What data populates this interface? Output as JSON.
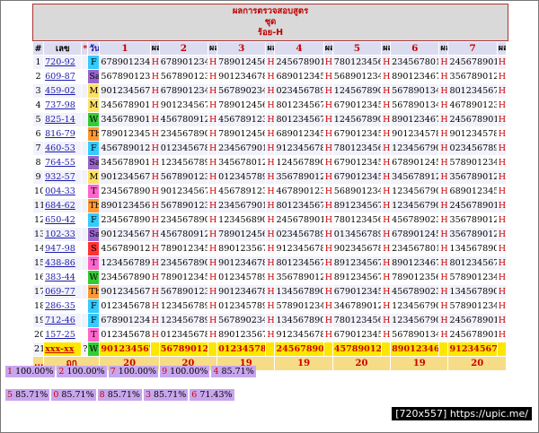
{
  "header": {
    "line1": "ผลการตรวจสอบสูตร",
    "line2": "ชุด",
    "line3": "ร้อย-H"
  },
  "columns": {
    "idx": "#",
    "label": "เลข",
    "star": "*",
    "day": "วัน",
    "digits": [
      "1",
      "2",
      "3",
      "4",
      "5",
      "6",
      "7"
    ],
    "pl": "ผล"
  },
  "day_colors": {
    "F": "#33ccff",
    "Sa": "#9966cc",
    "M": "#ffe066",
    "W": "#33cc33",
    "Th": "#ff9933",
    "S": "#ff3333",
    "T": "#ff66cc",
    "?": "#ffffff"
  },
  "rows": [
    {
      "i": "1",
      "label": "720-92",
      "day": "F",
      "vals": [
        "678901234",
        "678901234",
        "789012456",
        "245678901",
        "780123456",
        "234567801",
        "245678901"
      ],
      "res": [
        "H",
        "H",
        "H",
        "H",
        "H",
        "H",
        "H"
      ]
    },
    {
      "i": "2",
      "label": "609-87",
      "day": "Sa",
      "vals": [
        "567890123",
        "567890123",
        "901234678",
        "689012345",
        "568901234",
        "890123467",
        "356789012"
      ],
      "res": [
        "H",
        "H",
        "H",
        "H",
        "H",
        "H",
        "H"
      ]
    },
    {
      "i": "3",
      "label": "459-02",
      "day": "M",
      "vals": [
        "901234567",
        "678901234",
        "567890234",
        "023456789",
        "124567890",
        "567890134",
        "801234567"
      ],
      "res": [
        "H",
        "H",
        "H",
        "H",
        "H",
        "H",
        "H"
      ]
    },
    {
      "i": "4",
      "label": "737-98",
      "day": "M",
      "vals": [
        "345678901",
        "901234567",
        "789012456",
        "801234567",
        "679012345",
        "567890134",
        "467890123"
      ],
      "res": [
        "H",
        "H",
        "H",
        "H",
        "H",
        "H",
        "H"
      ]
    },
    {
      "i": "5",
      "label": "825-14",
      "day": "W",
      "vals": [
        "345678901",
        "456780912",
        "456789123",
        "801234567",
        "124567890",
        "890123467",
        "245678901"
      ],
      "res": [
        "H",
        "H",
        "H",
        "H",
        "H",
        "H",
        "H"
      ]
    },
    {
      "i": "6",
      "label": "816-79",
      "day": "Th",
      "vals": [
        "789012345",
        "234567890",
        "789012456",
        "689012345",
        "679012345",
        "901234578",
        "901234578"
      ],
      "res": [
        "H",
        "H",
        "H",
        "H",
        "H",
        "H",
        "H"
      ]
    },
    {
      "i": "7",
      "label": "460-53",
      "day": "F",
      "vals": [
        "456789012",
        "012345678",
        "234567901",
        "912345678",
        "780123456",
        "123456790",
        "023456789"
      ],
      "res": [
        "H",
        "H",
        "H",
        "H",
        "H",
        "H",
        "H"
      ]
    },
    {
      "i": "8",
      "label": "764-55",
      "day": "Sa",
      "vals": [
        "345678901",
        "123456789",
        "345678012",
        "124567890",
        "679012345",
        "678901245",
        "578901234"
      ],
      "res": [
        "H",
        "H",
        "H",
        "H",
        "H",
        "H",
        "H"
      ]
    },
    {
      "i": "9",
      "label": "932-57",
      "day": "M",
      "vals": [
        "901234567",
        "567890123",
        "012345789",
        "356789012",
        "679012345",
        "345678912",
        "356789012"
      ],
      "res": [
        "H",
        "H",
        "H",
        "H",
        "H",
        "H",
        "H"
      ]
    },
    {
      "i": "10",
      "label": "004-33",
      "day": "T",
      "vals": [
        "234567890",
        "901234567",
        "456789123",
        "467890123",
        "568901234",
        "123456790",
        "689012345"
      ],
      "res": [
        "H",
        "H",
        "H",
        "H",
        "H",
        "H",
        "H"
      ]
    },
    {
      "i": "11",
      "label": "684-62",
      "day": "Th",
      "vals": [
        "890123456",
        "567890123",
        "234567901",
        "801234567",
        "891234567",
        "123456790",
        "245678901"
      ],
      "res": [
        "H",
        "H",
        "H",
        "H",
        "H",
        "H",
        "H"
      ]
    },
    {
      "i": "12",
      "label": "650-42",
      "day": "F",
      "vals": [
        "234567890",
        "234567890",
        "123456890",
        "245678901",
        "780123456",
        "456789023",
        "356789012"
      ],
      "res": [
        "H",
        "H",
        "H",
        "H",
        "H",
        "H",
        "H"
      ]
    },
    {
      "i": "13",
      "label": "102-33",
      "day": "Sa",
      "vals": [
        "901234567",
        "456780912",
        "789012456",
        "023456789",
        "013456789",
        "678901245",
        "356789012"
      ],
      "res": [
        "H",
        "H",
        "H",
        "H",
        "H",
        "H",
        "H"
      ]
    },
    {
      "i": "14",
      "label": "947-98",
      "day": "S",
      "vals": [
        "456789012",
        "789012345",
        "890123567",
        "912345678",
        "902345678",
        "234567801",
        "134567890"
      ],
      "res": [
        "H",
        "H",
        "H",
        "H",
        "H",
        "H",
        "H"
      ]
    },
    {
      "i": "15",
      "label": "438-86",
      "day": "T",
      "vals": [
        "123456789",
        "234567890",
        "901234678",
        "801234567",
        "891234567",
        "890123467",
        "801234567"
      ],
      "res": [
        "H",
        "H",
        "H",
        "H",
        "H",
        "H",
        "H"
      ]
    },
    {
      "i": "16",
      "label": "383-44",
      "day": "W",
      "vals": [
        "234567890",
        "789012345",
        "012345789",
        "356789012",
        "891234567",
        "789012356",
        "578901234"
      ],
      "res": [
        "H",
        "H",
        "H",
        "H",
        "H",
        "H",
        "H"
      ]
    },
    {
      "i": "17",
      "label": "069-77",
      "day": "Th",
      "vals": [
        "901234567",
        "567890123",
        "901234678",
        "134567890",
        "679012345",
        "456789023",
        "134567890"
      ],
      "res": [
        "H",
        "H",
        "H",
        "H",
        "H",
        "H",
        "H"
      ]
    },
    {
      "i": "18",
      "label": "286-35",
      "day": "F",
      "vals": [
        "012345678",
        "123456789",
        "012345789",
        "578901234",
        "346789012",
        "123456790",
        "578901234"
      ],
      "res": [
        "H",
        "H",
        "H",
        "H",
        "H",
        "H",
        "H"
      ]
    },
    {
      "i": "19",
      "label": "712-46",
      "day": "F",
      "vals": [
        "678901234",
        "123456789",
        "567890234",
        "134567890",
        "780123456",
        "123456790",
        "245678901"
      ],
      "res": [
        "H",
        "H",
        "H",
        "H",
        "H",
        "H",
        "H"
      ]
    },
    {
      "i": "20",
      "label": "157-25",
      "day": "T",
      "vals": [
        "012345678",
        "012345678",
        "890123567",
        "912345678",
        "679012345",
        "567890134",
        "245678901"
      ],
      "res": [
        "H",
        "H",
        "H",
        "H",
        "H",
        "H",
        "H"
      ]
    }
  ],
  "last_row": {
    "i": "21",
    "label": "xxx-xx",
    "star": "?",
    "day": "W",
    "vals": [
      "901234567",
      "567890123",
      "012345789",
      "245678901",
      "457890123",
      "890123467",
      "912345678"
    ]
  },
  "summary": {
    "dots": "...",
    "label": "ถูก",
    "counts": [
      "20",
      "20",
      "19",
      "19",
      "20",
      "19",
      "20"
    ]
  },
  "stats_line1": [
    {
      "n": "1",
      "pct": "100.00%"
    },
    {
      "n": "2",
      "pct": "100.00%"
    },
    {
      "n": "7",
      "pct": "100.00%"
    },
    {
      "n": "9",
      "pct": "100.00%"
    },
    {
      "n": "4",
      "pct": "85.71%"
    }
  ],
  "stats_line2": [
    {
      "n": "5",
      "pct": "85.71%"
    },
    {
      "n": "0",
      "pct": "85.71%"
    },
    {
      "n": "8",
      "pct": "85.71%"
    },
    {
      "n": "3",
      "pct": "85.71%"
    },
    {
      "n": "6",
      "pct": "71.43%"
    }
  ],
  "watermark": "[720x557] https://upic.me/"
}
